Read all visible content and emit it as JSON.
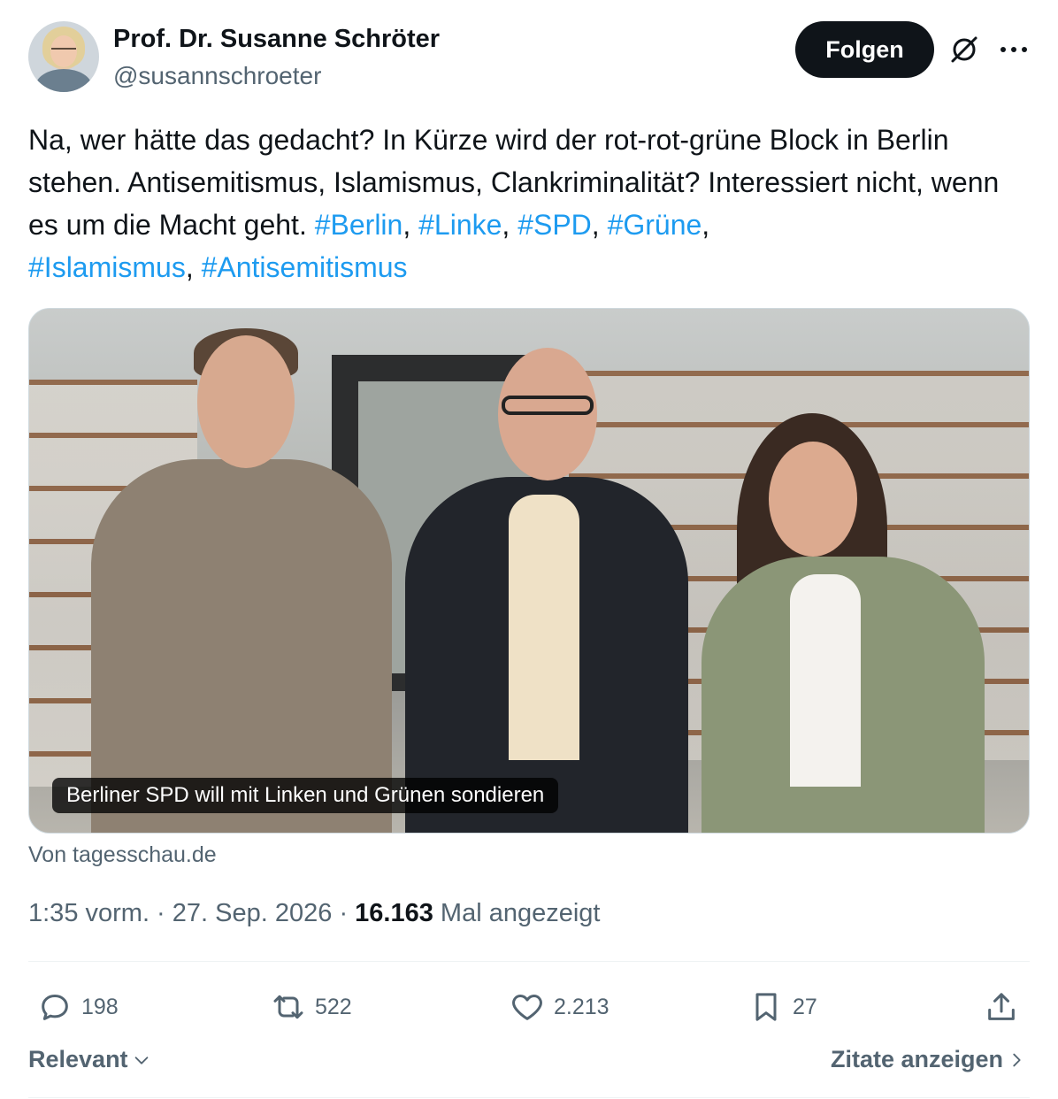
{
  "author": {
    "name": "Prof. Dr. Susanne Schröter",
    "handle": "@susannschroeter"
  },
  "header": {
    "follow_label": "Folgen",
    "icons": [
      "grok-icon",
      "more-icon"
    ]
  },
  "tweet": {
    "text_plain": "Na, wer hätte das gedacht? In Kürze wird der rot-rot-grüne Block in Berlin stehen. Antisemitismus, Islamismus, Clankriminalität? Interessiert nicht, wenn es um die Macht geht. ",
    "hashtags": [
      "#Berlin",
      "#Linke",
      "#SPD",
      "#Grüne",
      "#Islamismus",
      "#Antisemitismus"
    ],
    "separator": ", ",
    "trailing_comma": ","
  },
  "media": {
    "caption": "Berliner SPD will mit Linken und Grünen sondieren",
    "source": "Von tagesschau.de"
  },
  "meta": {
    "time": "1:35 vorm.",
    "dot": " · ",
    "date": "27. Sep. 2026",
    "views_count": "16.163",
    "views_label": " Mal angezeigt"
  },
  "actions": {
    "replies": "198",
    "retweets": "522",
    "likes": "2.213",
    "bookmarks": "27"
  },
  "footer": {
    "sort_label": "Relevant",
    "quotes_label": "Zitate anzeigen"
  },
  "colors": {
    "text": "#0f1419",
    "secondary": "#536471",
    "link": "#1d9bf0",
    "button_bg": "#0f1419"
  }
}
